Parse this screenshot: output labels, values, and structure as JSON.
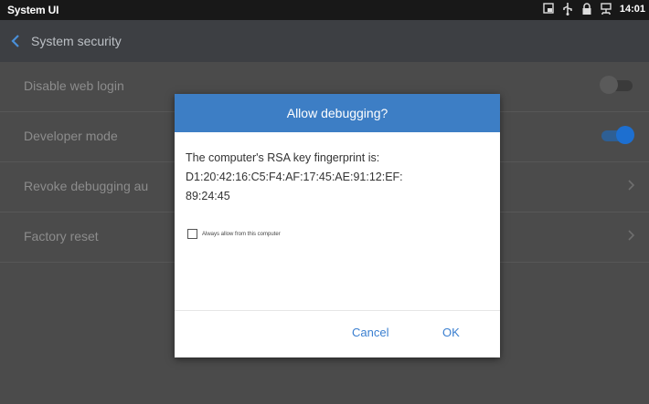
{
  "status_bar": {
    "title": "System UI",
    "time": "14:01",
    "icons": [
      "screenshot-icon",
      "usb-icon",
      "lock-icon",
      "network-icon"
    ]
  },
  "toolbar": {
    "title": "System security"
  },
  "settings": {
    "rows": [
      {
        "label": "Disable web login",
        "control": "toggle",
        "state": "off"
      },
      {
        "label": "Developer mode",
        "control": "toggle",
        "state": "on"
      },
      {
        "label": "Revoke debugging au",
        "control": "chevron"
      },
      {
        "label": "Factory reset",
        "control": "chevron"
      }
    ]
  },
  "dialog": {
    "title": "Allow debugging?",
    "message_line1": "The computer's RSA key fingerprint is:",
    "message_line2": "D1:20:42:16:C5:F4:AF:17:45:AE:91:12:EF:",
    "message_line3": "89:24:45",
    "checkbox_label": "Always allow from this computer",
    "checkbox_checked": false,
    "cancel_label": "Cancel",
    "ok_label": "OK"
  },
  "colors": {
    "accent": "#3d7ec5",
    "toggle_on": "#1d6fd0",
    "toggle_on_track": "#2e5f94",
    "toggle_off_knob": "#5a5a5a",
    "toggle_off_track": "#3a3a3a"
  }
}
